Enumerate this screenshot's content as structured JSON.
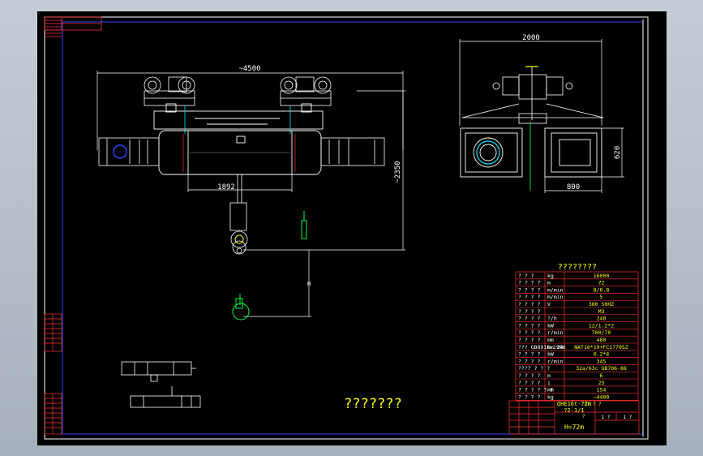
{
  "drawing": {
    "dim_width_total": "~4500",
    "dim_height": "~2350",
    "dim_span_side": "2000",
    "dim_620": "620",
    "dim_800": "800",
    "dim_1892": "1892",
    "dim_h_marker": "H",
    "caption_chinese": "???????"
  },
  "spec_table": {
    "title": "????????",
    "rows": [
      {
        "label": "? ? ?",
        "unit": "kg",
        "value": "16000"
      },
      {
        "label": "? ? ? ?",
        "unit": "m",
        "value": "72"
      },
      {
        "label": "? ? ? ?",
        "unit": "m/min",
        "value": "8/0.8"
      },
      {
        "label": "? ? ? ?",
        "unit": "m/min",
        "value": "5"
      },
      {
        "label": "? ? ? ?",
        "unit": "V",
        "value": "380      50HZ"
      },
      {
        "label": "? ? ? ?",
        "unit": "",
        "value": "M3"
      },
      {
        "label": "? ? ? ?",
        "unit": "?/h",
        "value": "240"
      },
      {
        "label": "? ? ? ?",
        "unit": "kW",
        "value": "12/1.2*2"
      },
      {
        "label": "? ? ? ?",
        "unit": "r/min",
        "value": "700/70"
      },
      {
        "label": "? ? ? ?",
        "unit": "mm",
        "value": "480"
      },
      {
        "label": "???  GB8918-1996",
        "unit": "mm   24",
        "value": "NAT16*19+FC1770SZ"
      },
      {
        "label": "? ? ? ?",
        "unit": "kW",
        "value": "0.2*4"
      },
      {
        "label": "? ? ? ?",
        "unit": "r/min",
        "value": "345"
      },
      {
        "label": "????  ? ? ?",
        "unit": "",
        "value": "32a/63c        GB706-88"
      },
      {
        "label": "? ? ? ?",
        "unit": "m",
        "value": "6"
      },
      {
        "label": "? ? ? ?",
        "unit": "i",
        "value": "23"
      },
      {
        "label": "? ? ? ? ? ?",
        "unit": "mm",
        "value": "154"
      },
      {
        "label": "? ? ? ?",
        "unit": "kg",
        "value": "~4400"
      }
    ]
  },
  "title_block": {
    "model": "QHE16t-72m",
    "scale_label": "?? ? ?",
    "scale": "?2-1/1",
    "sheet": "?",
    "height": "H=72m",
    "sheet_count": "1 ?",
    "total_sheets": "1 ?"
  }
}
